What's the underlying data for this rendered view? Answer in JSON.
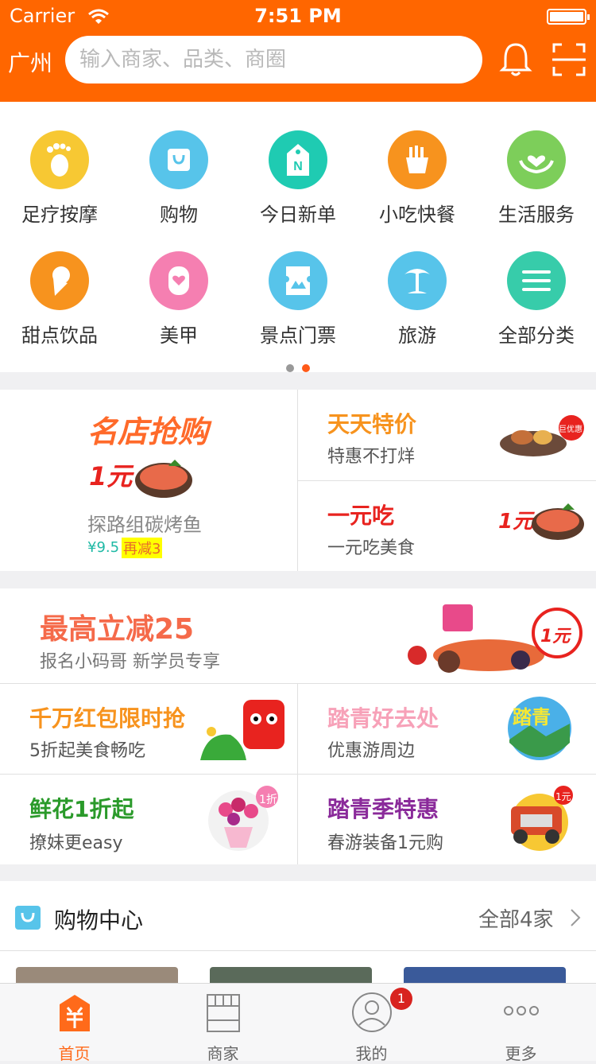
{
  "status_bar": {
    "carrier": "Carrier",
    "time": "7:51 PM"
  },
  "header": {
    "city": "广州",
    "search_placeholder": "输入商家、品类、商圈"
  },
  "categories": [
    {
      "label": "足疗按摩",
      "icon": "foot-icon",
      "color": "#f7c833"
    },
    {
      "label": "购物",
      "icon": "shopping-bag-icon",
      "color": "#57c4ea"
    },
    {
      "label": "今日新单",
      "icon": "new-tag-icon",
      "color": "#1fcbb2"
    },
    {
      "label": "小吃快餐",
      "icon": "fries-icon",
      "color": "#f7931e"
    },
    {
      "label": "生活服务",
      "icon": "heart-hands-icon",
      "color": "#7dce5a"
    },
    {
      "label": "甜点饮品",
      "icon": "ice-cream-icon",
      "color": "#f7931e"
    },
    {
      "label": "美甲",
      "icon": "nail-heart-icon",
      "color": "#f57fb1"
    },
    {
      "label": "景点门票",
      "icon": "ticket-icon",
      "color": "#57c4ea"
    },
    {
      "label": "旅游",
      "icon": "palm-tree-icon",
      "color": "#57c4ea"
    },
    {
      "label": "全部分类",
      "icon": "menu-icon",
      "color": "#37ccaa"
    }
  ],
  "page_dots": {
    "total": 2,
    "active": 2
  },
  "promo1": {
    "main_title": "名店抢购",
    "main_badge": "1元",
    "main_subtitle": "探路组碳烤鱼",
    "main_price": "¥9.5",
    "main_discount": "再减3",
    "card1_title": "天天特价",
    "card1_subtitle": "特惠不打烊",
    "card1_badge": "巨优惠",
    "card2_title": "一元吃",
    "card2_subtitle": "一元吃美食",
    "card2_badge": "1元"
  },
  "promo2": {
    "banner_title": "最高立减25",
    "banner_subtitle": "报名小码哥 新学员专享",
    "banner_badge": "1元",
    "c1_title": "千万红包限时抢",
    "c1_subtitle": "5折起美食畅吃",
    "c2_title": "踏青好去处",
    "c2_subtitle": "优惠游周边",
    "c2_badge": "踏青",
    "c3_title": "鲜花1折起",
    "c3_subtitle": "撩妹更easy",
    "c3_badge": "1折",
    "c4_title": "踏青季特惠",
    "c4_subtitle": "春游装备1元购",
    "c4_badge": "1元"
  },
  "shopping_center": {
    "title": "购物中心",
    "more": "全部4家"
  },
  "tabbar": [
    {
      "label": "首页",
      "icon": "home-sheep-icon",
      "active": true
    },
    {
      "label": "商家",
      "icon": "store-icon",
      "active": false
    },
    {
      "label": "我的",
      "icon": "user-icon",
      "active": false,
      "badge": "1"
    },
    {
      "label": "更多",
      "icon": "more-dots-icon",
      "active": false
    }
  ],
  "colors": {
    "brand": "#ff6600",
    "promo_orange": "#f7931e",
    "promo_red": "#e8231f",
    "discount_bg": "#ffff00"
  }
}
